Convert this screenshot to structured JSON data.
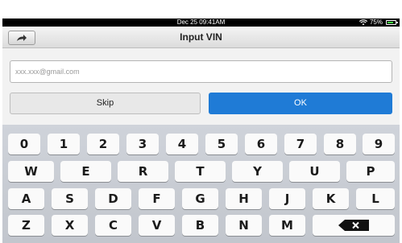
{
  "status_bar": {
    "time": "Dec 25 09:41AM",
    "battery_percent": "75%",
    "battery_level": 0.75
  },
  "header": {
    "title": "Input VIN"
  },
  "vin_input": {
    "placeholder": "xxx.xxx@gmail.com",
    "value": ""
  },
  "buttons": {
    "skip": "Skip",
    "ok": "OK"
  },
  "keyboard": {
    "row1": [
      "0",
      "1",
      "2",
      "3",
      "4",
      "5",
      "6",
      "7",
      "8",
      "9"
    ],
    "row2": [
      "W",
      "E",
      "R",
      "T",
      "Y",
      "U",
      "P"
    ],
    "row3": [
      "A",
      "S",
      "D",
      "F",
      "G",
      "H",
      "J",
      "K",
      "L"
    ],
    "row4": [
      "Z",
      "X",
      "C",
      "V",
      "B",
      "N",
      "M"
    ]
  },
  "icons": [
    "share-icon",
    "wifi-icon",
    "battery-icon",
    "backspace-icon"
  ],
  "colors": {
    "ok_button": "#1f7bd6",
    "battery_fill": "#3fd43f"
  }
}
